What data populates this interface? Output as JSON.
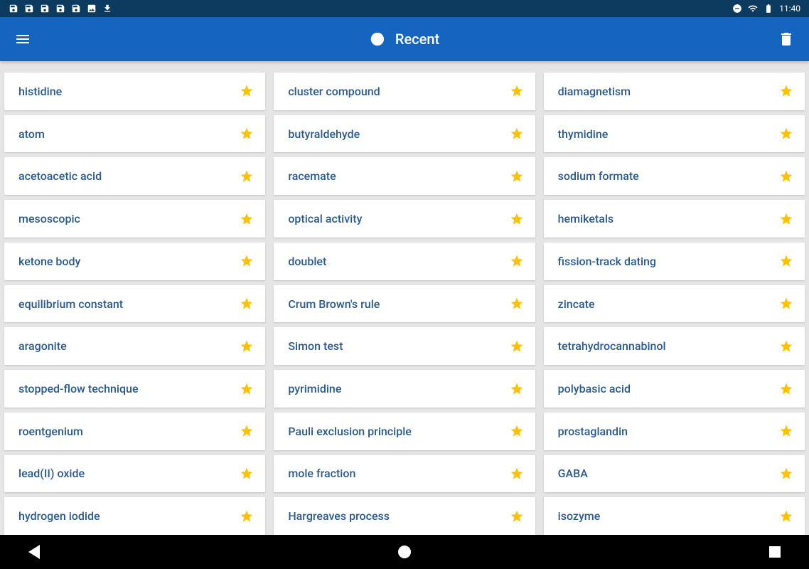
{
  "status": {
    "time": "11:40"
  },
  "header": {
    "title": "Recent"
  },
  "columns": [
    [
      "histidine",
      "atom",
      "acetoacetic acid",
      "mesoscopic",
      "ketone body",
      "equilibrium constant",
      "aragonite",
      "stopped-flow technique",
      "roentgenium",
      "lead(II) oxide",
      "hydrogen iodide"
    ],
    [
      "cluster compound",
      "butyraldehyde",
      "racemate",
      "optical activity",
      "doublet",
      "Crum Brown's rule",
      "Simon test",
      "pyrimidine",
      "Pauli exclusion principle",
      "mole fraction",
      "Hargreaves process"
    ],
    [
      "diamagnetism",
      "thymidine",
      "sodium formate",
      "hemiketals",
      "fission-track dating",
      "zincate",
      "tetrahydrocannabinol",
      "polybasic acid",
      "prostaglandin",
      "GABA",
      "isozyme"
    ]
  ]
}
